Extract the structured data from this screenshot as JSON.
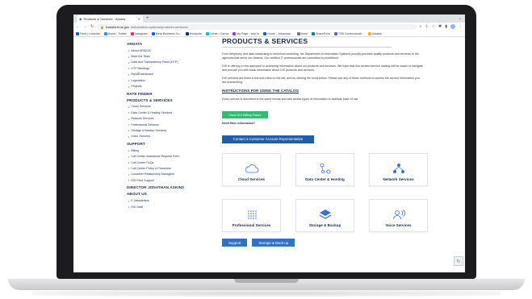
{
  "browser": {
    "tab_title": "Products & Services - Arkans",
    "url_host": "transform.ar.gov",
    "url_path": "/information-systems/products-services/",
    "bookmarks": [
      {
        "label": "Feed | LinkedIn",
        "color": "#0a66c2"
      },
      {
        "label": "Home / Twitter",
        "color": "#1d9bf0"
      },
      {
        "label": "Instagram",
        "color": "#e1306c"
      },
      {
        "label": "Meta Business Su...",
        "color": "#0866ff"
      },
      {
        "label": "Hootsuite",
        "color": "#143059"
      },
      {
        "label": "Home • Canva",
        "color": "#00c4cc"
      },
      {
        "label": "My Page · solo.to",
        "color": "#8e44ad"
      },
      {
        "label": "Home – Arkansas...",
        "color": "#1f5fa8"
      },
      {
        "label": "Mock",
        "color": "#777777"
      },
      {
        "label": "SharePoint",
        "color": "#038387"
      },
      {
        "label": "TSB Communicati...",
        "color": "#6264a7"
      },
      {
        "label": "Airtable",
        "color": "#fcb400"
      }
    ]
  },
  "sidebar": {
    "sections": [
      {
        "heading": "ARDATA",
        "items": [
          "About ARDATA",
          "Meet the Team",
          "Data and Transparency Panel (DTP)",
          "DTP Meetings",
          "MyARDashboard",
          "Legislation",
          "Projects"
        ]
      },
      {
        "heading": "RATE FINDER",
        "items": []
      },
      {
        "heading": "PRODUCTS & SERVICES",
        "items": [
          "Cloud Services",
          "Data Center & Hosting Services",
          "Network Services",
          "Professional Services",
          "Storage & Backup Services",
          "Voice Services"
        ]
      },
      {
        "heading": "SUPPORT",
        "items": [
          "Billing",
          "Call Center Assistance Request Form",
          "Call Center FAQs",
          "Call Center Policy & Procedure",
          "Customer Relationship Managers",
          "DIS Field Support"
        ]
      },
      {
        "heading": "DIRECTOR JONATHAN ASKINS",
        "items": []
      },
      {
        "heading": "ABOUT US",
        "items": [
          "E-Newsletters",
          "DIS Staff"
        ]
      }
    ]
  },
  "main": {
    "title": "PRODUCTS & SERVICES",
    "paragraphs": [
      "From telephony and data networking to technical consulting, the Department of Information Systems proudly provides quality products and services to the agencies that serve our citizens. Our certified IT professionals are committed to excellence.",
      "DIS is offering a new approach to accessing information about our products and services. We hope that this revised service catalog will be easier to navigate and provide you with basic information about DIS products and services.",
      "DIS services are listed in the sub-menu to the left, and by clicking the icons below. Please use any of these methods to access the service information you are researching."
    ],
    "instructions_heading": "INSTRUCTIONS FOR USING THE CATALOG",
    "instructions_text": "Every service is described in the same format and with similar types of information to facilitate ease of use.",
    "billing_button": "View DIS Billing Rates",
    "need_more": "Need More Information?",
    "contact_button": "Contact a Customer Account Representative",
    "cards": [
      {
        "label": "Cloud Services",
        "icon": "cloud-icon"
      },
      {
        "label": "Data Center & Hosting",
        "icon": "nodes-icon"
      },
      {
        "label": "Network Services",
        "icon": "network-icon"
      },
      {
        "label": "Professional Services",
        "icon": "grid-dots-icon"
      },
      {
        "label": "Storage & Backup",
        "icon": "layers-icon"
      },
      {
        "label": "Voice Services",
        "icon": "voice-icon"
      }
    ],
    "bottom_buttons": [
      "Support",
      "Storage & Back-up"
    ]
  },
  "colors": {
    "navy": "#1b2a4a",
    "green": "#2dbd73",
    "blue": "#1f5fa8",
    "icon_blue": "#3b6fd4"
  }
}
